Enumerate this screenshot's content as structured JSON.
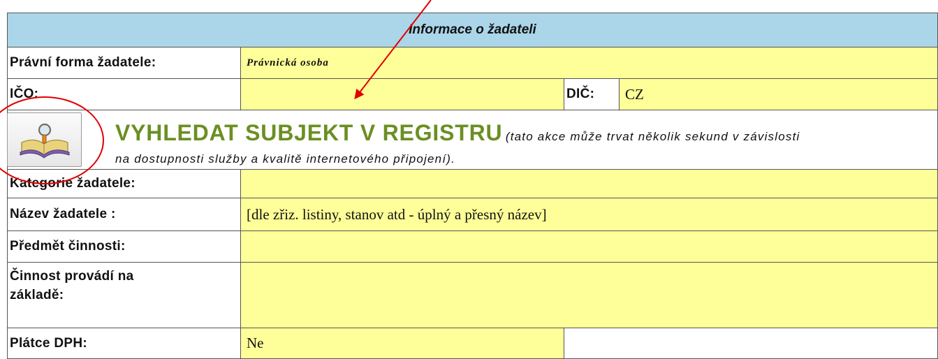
{
  "form": {
    "header": "Informace o žadateli",
    "legal_form": {
      "label": "Právní forma žadatele:",
      "value": "Právnická osoba"
    },
    "ico": {
      "label": "IČO:",
      "value": ""
    },
    "dic": {
      "label": "DIČ:",
      "value": "CZ"
    },
    "search": {
      "title": "VYHLEDAT SUBJEKT V REGISTRU",
      "note_part1": "(tato akce může trvat několik sekund v závislosti",
      "note_part2": "na dostupnosti služby a kvalitě internetového připojení)."
    },
    "category": {
      "label": "Kategorie žadatele:",
      "value": ""
    },
    "name": {
      "label": "Název žadatele :",
      "value": "[dle zřiz. listiny, stanov atd - úplný a přesný název]"
    },
    "activity": {
      "label": "Předmět činnosti:",
      "value": ""
    },
    "basis": {
      "label_line1": "Činnost provádí na",
      "label_line2": "základě:",
      "value": ""
    },
    "vat": {
      "label": "Plátce DPH:",
      "value": "Ne"
    }
  },
  "colors": {
    "header_bg": "#abd6ea",
    "field_bg": "#ffff99",
    "search_title": "#6b8f23",
    "annotation": "#e00000"
  },
  "icons": {
    "search_button": "book-magnifier-icon"
  }
}
